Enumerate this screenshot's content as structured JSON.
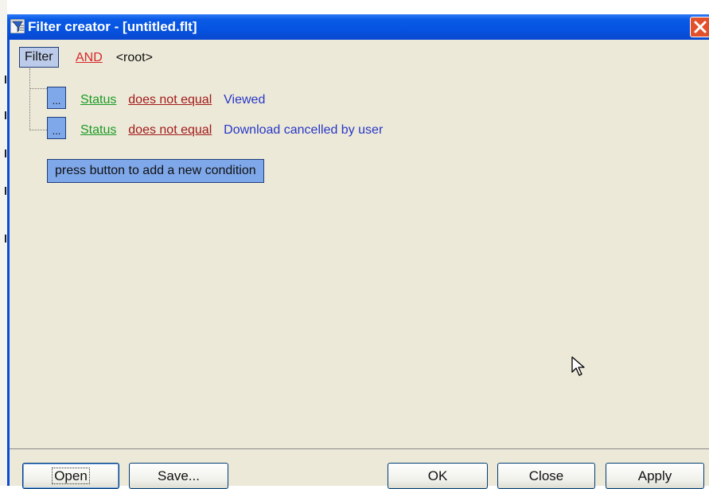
{
  "window": {
    "title": "Filter creator - [untitled.flt]"
  },
  "tree": {
    "root": {
      "type_label": "Filter",
      "operator": "AND",
      "name": "<root>"
    },
    "conditions": [
      {
        "button_label": "...",
        "field": "Status",
        "operator": "does not equal",
        "value": "Viewed"
      },
      {
        "button_label": "...",
        "field": "Status",
        "operator": "does not equal",
        "value": "Download cancelled by user"
      }
    ],
    "add_condition_label": "press button to add a new condition"
  },
  "buttons": {
    "open": "Open",
    "save": "Save...",
    "ok": "OK",
    "close": "Close",
    "apply": "Apply"
  },
  "colors": {
    "titlebar": "#0553e0",
    "client_bg": "#ece9d8",
    "field_link": "#1a9a23",
    "operator_link": "#a21a1a",
    "value_text": "#2736c7",
    "and_link": "#d8272a",
    "node_box": "#7fa8ea"
  }
}
